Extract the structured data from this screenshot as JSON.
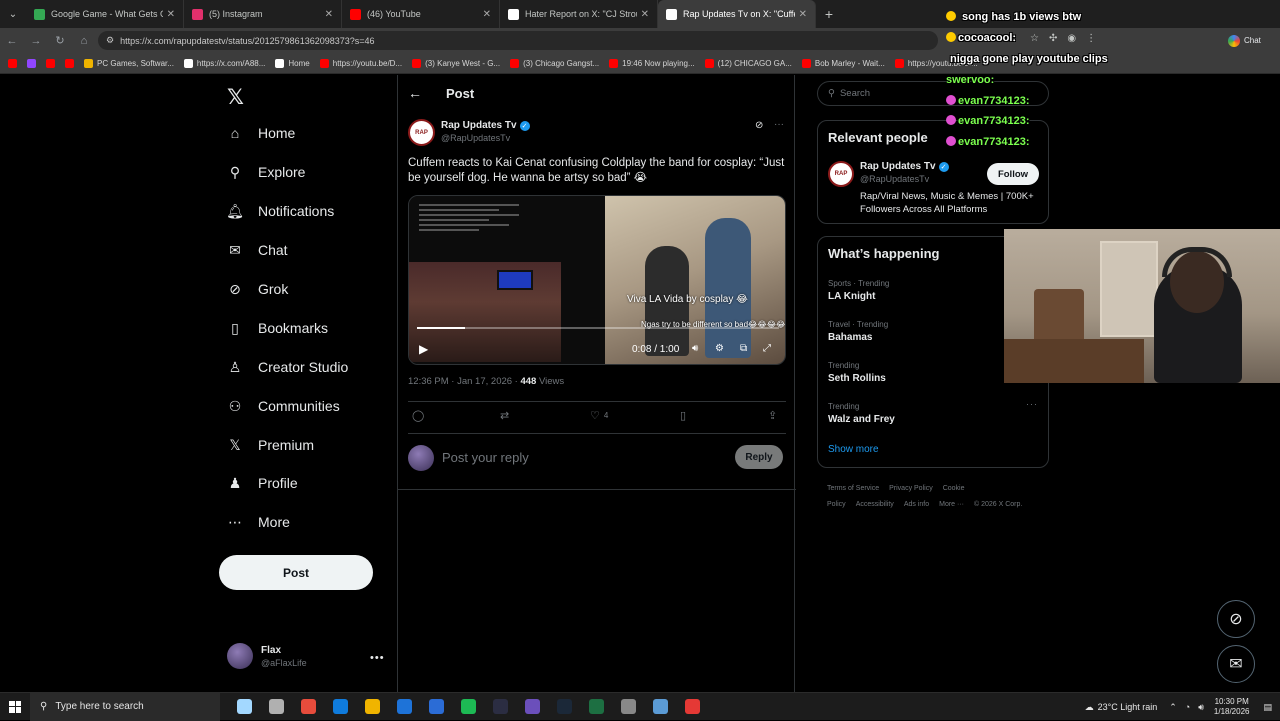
{
  "tabs": [
    {
      "title": "Google Game - What Gets Google",
      "color": "#34a853"
    },
    {
      "title": "(5) Instagram",
      "color": "#e1306c"
    },
    {
      "title": "(46) YouTube",
      "color": "#ff0000"
    },
    {
      "title": "Hater Report on X: \"CJ Stroud tryin",
      "color": "#ffffff"
    },
    {
      "title": "Rap Updates Tv on X: \"Cuffem rea",
      "color": "#ffffff"
    }
  ],
  "address": {
    "url": "https://x.com/rapupdatestv/status/2012579861362098373?s=46"
  },
  "browser_chat_label": "Chat",
  "bookmarks": [
    {
      "label": "",
      "color": "#ff0000"
    },
    {
      "label": "",
      "color": "#9146ff"
    },
    {
      "label": "",
      "color": "#ff0000"
    },
    {
      "label": "",
      "color": "#ff0000"
    },
    {
      "label": "PC Games, Softwar...",
      "color": "#f0b400"
    },
    {
      "label": "https://x.com/A88...",
      "color": "#ffffff"
    },
    {
      "label": "Home",
      "color": "#ffffff"
    },
    {
      "label": "https://youtu.be/D...",
      "color": "#ff0000"
    },
    {
      "label": "(3) Kanye West - G...",
      "color": "#ff0000"
    },
    {
      "label": "(3) Chicago Gangst...",
      "color": "#ff0000"
    },
    {
      "label": "19:46 Now playing...",
      "color": "#ff0000"
    },
    {
      "label": "(12) CHICAGO GA...",
      "color": "#ff0000"
    },
    {
      "label": "Bob Marley - Wait...",
      "color": "#ff0000"
    },
    {
      "label": "https://youtu.be/bl...",
      "color": "#ff0000"
    }
  ],
  "sidebar": {
    "items": [
      {
        "label": "Home",
        "icon": "home-icon",
        "glyph": "⌂"
      },
      {
        "label": "Explore",
        "icon": "search-icon",
        "glyph": "⚲"
      },
      {
        "label": "Notifications",
        "icon": "bell-icon",
        "glyph": "🔔︎"
      },
      {
        "label": "Chat",
        "icon": "mail-icon",
        "glyph": "✉"
      },
      {
        "label": "Grok",
        "icon": "grok-icon",
        "glyph": "⊘"
      },
      {
        "label": "Bookmarks",
        "icon": "bookmark-icon",
        "glyph": "▯"
      },
      {
        "label": "Creator Studio",
        "icon": "creator-studio-icon",
        "glyph": "♙"
      },
      {
        "label": "Communities",
        "icon": "communities-icon",
        "glyph": "⚇"
      },
      {
        "label": "Premium",
        "icon": "x-logo-icon",
        "glyph": "𝕏"
      },
      {
        "label": "Profile",
        "icon": "person-icon",
        "glyph": "♟"
      },
      {
        "label": "More",
        "icon": "more-circle-icon",
        "glyph": "⋯"
      }
    ],
    "post_label": "Post",
    "account": {
      "name": "Flax",
      "handle": "@aFlaxLife"
    }
  },
  "main": {
    "title": "Post",
    "tweet": {
      "name": "Rap Updates Tv",
      "handle": "@RapUpdatesTv",
      "text": "Cuffem reacts to Kai Cenat confusing Coldplay the band for cosplay: “Just be yourself dog. He wanna be artsy so bad” 😭",
      "caption_main": "Viva LA Vida by cosplay 😂",
      "caption_sub": "Ngas try to be different so bad😂😂😂😂",
      "video_time": "0:08 / 1:00",
      "video_progress": 0.133,
      "timestamp": "12:36 PM · Jan 17, 2026 ·",
      "views_count": "448",
      "views_label": "Views",
      "like_count": "4"
    },
    "reply_placeholder": "Post your reply",
    "reply_label": "Reply"
  },
  "right": {
    "search_placeholder": "Search",
    "relevant": {
      "title": "Relevant people",
      "name": "Rap Updates Tv",
      "handle": "@RapUpdatesTv",
      "bio": "Rap/Viral News, Music & Memes | 700K+ Followers Across All Platforms",
      "follow_label": "Follow"
    },
    "happening": {
      "title": "What’s happening",
      "trends": [
        {
          "category": "Sports · Trending",
          "name": "LA Knight"
        },
        {
          "category": "Travel · Trending",
          "name": "Bahamas"
        },
        {
          "category": "Trending",
          "name": "Seth Rollins"
        },
        {
          "category": "Trending",
          "name": "Walz and Frey"
        }
      ],
      "show_more": "Show more"
    },
    "footer": [
      "Terms of Service",
      "Privacy Policy",
      "Cookie Policy",
      "Accessibility",
      "Ads info",
      "More ···",
      "© 2026 X Corp."
    ]
  },
  "stream_chat": [
    {
      "user": "",
      "text": "song has 1b views btw",
      "user_color": "#ff3b3b",
      "badge": "#ffcc00"
    },
    {
      "user": "cocoacool:",
      "text": "",
      "user_color": "#ffffff",
      "badge": "#ffcc00"
    },
    {
      "user": "",
      "text": "nigga gone play youtube clips",
      "user_color": "#ffffff",
      "badge": ""
    },
    {
      "user": "swervoo:",
      "text": "",
      "user_color": "#7cff4f",
      "badge": ""
    },
    {
      "user": "evan7734123:",
      "text": "",
      "user_color": "#7cff4f",
      "badge": "#e04fd0"
    },
    {
      "user": "evan7734123:",
      "text": "",
      "user_color": "#7cff4f",
      "badge": "#e04fd0"
    },
    {
      "user": "evan7734123:",
      "text": "",
      "user_color": "#7cff4f",
      "badge": "#e04fd0"
    }
  ],
  "taskbar": {
    "search_placeholder": "Type here to search",
    "weather": "23°C  Light rain",
    "time": "10:30 PM",
    "date": "1/18/2026",
    "apps": [
      "#a3d8ff",
      "#b0b0b0",
      "#e74c3c",
      "#0f7bdc",
      "#f0b400",
      "#1e73d8",
      "#2b6cd6",
      "#1db954",
      "#2b2d42",
      "#6b4fbb",
      "#1b2838",
      "#1d6f42",
      "#888888",
      "#5b9bd5",
      "#e53935"
    ]
  }
}
